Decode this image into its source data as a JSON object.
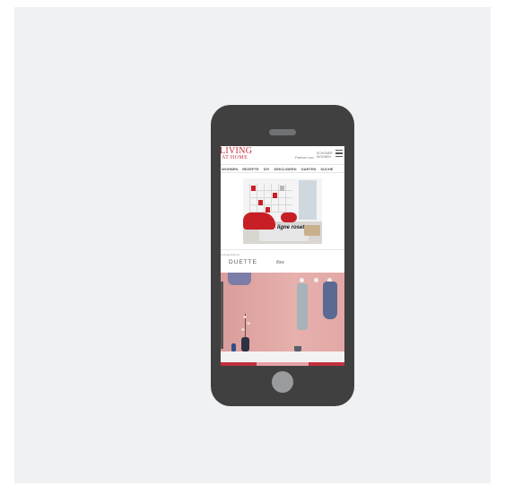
{
  "site": {
    "logo_line1": "LIVING",
    "logo_line2": "AT HOME",
    "partner_label": "Partner von",
    "partner_logo": "SCHÖNER WOHNEN"
  },
  "nav": {
    "items": [
      "WOHNEN",
      "REZEPTE",
      "DIY",
      "DEKO-IDEEN",
      "GARTEN",
      "SUCHE"
    ]
  },
  "ads": {
    "ad1_brand": "ligne roset",
    "ad2_label": "Anzeige/Partner",
    "ad2_brand1": "DUETTE",
    "ad2_brand2": "flow"
  },
  "colors": {
    "accent": "#c0303d",
    "phone_body": "#404041",
    "background": "#f0f1f3"
  },
  "icons": [
    "menu-icon",
    "speaker-icon",
    "home-button-icon"
  ]
}
